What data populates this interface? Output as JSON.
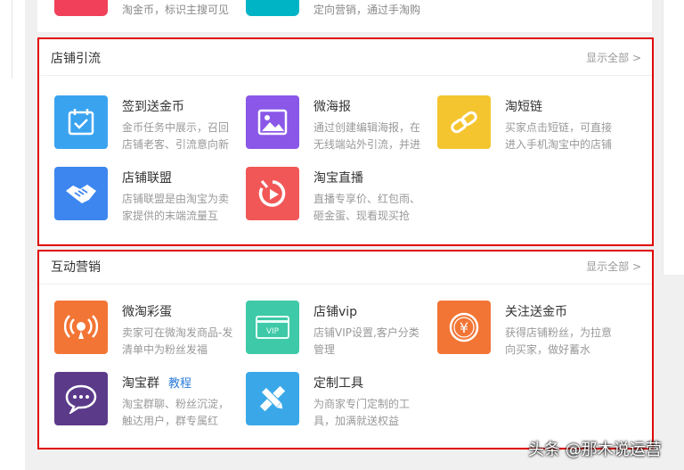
{
  "top_items": [
    {
      "desc": "淘金币，标识主搜可见",
      "color": "#f0405a"
    },
    {
      "desc": "定向营销，通过手淘购",
      "color": "#00b4c6"
    }
  ],
  "sections": [
    {
      "title": "店铺引流",
      "more": "显示全部 >",
      "items": [
        {
          "name": "签到送金币",
          "desc": "金币任务中展示，召回店铺老客、引流意向新",
          "icon": "calendar-check-icon",
          "color": "#3aa3f0"
        },
        {
          "name": "微海报",
          "desc": "通过创建编辑海报，在无线端站外引流，并进",
          "icon": "picture-icon",
          "color": "#8a57e8"
        },
        {
          "name": "淘短链",
          "desc": "买家点击短链，可直接进入手机淘宝中的店铺",
          "icon": "link-icon",
          "color": "#f5c530"
        },
        {
          "name": "店铺联盟",
          "desc": "店铺联盟是由淘宝为卖家提供的末端流量互",
          "icon": "handshake-icon",
          "color": "#3d86f0"
        },
        {
          "name": "淘宝直播",
          "desc": "直播专享价、红包雨、砸金蛋、现看现买抢",
          "icon": "live-play-icon",
          "color": "#f25757"
        }
      ]
    },
    {
      "title": "互动营销",
      "more": "显示全部 >",
      "items": [
        {
          "name": "微淘彩蛋",
          "desc": "卖家可在微淘发商品-发清单中为粉丝发福",
          "icon": "broadcast-icon",
          "color": "#f37535"
        },
        {
          "name": "店铺vip",
          "desc": "店铺VIP设置,客户分类管理",
          "icon": "vip-card-icon",
          "color": "#3ec9a8"
        },
        {
          "name": "关注送金币",
          "desc": "获得店铺粉丝，为拉意向买家，做好蓄水",
          "icon": "yen-coin-icon",
          "color": "#f37535"
        },
        {
          "name": "淘宝群",
          "tag": "教程",
          "desc": "淘宝群聊、粉丝沉淀，触达用户，群专属红",
          "icon": "chat-bubble-icon",
          "color": "#5b3a8a"
        },
        {
          "name": "定制工具",
          "desc": "为商家专门定制的工具，加满就送权益",
          "icon": "ruler-pencil-icon",
          "color": "#3aa8e8"
        }
      ]
    }
  ],
  "watermark": "头条 @那木说运营"
}
